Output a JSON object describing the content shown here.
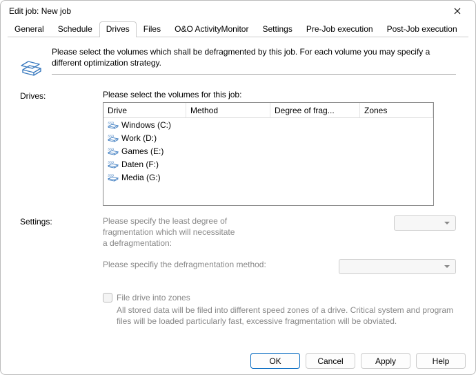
{
  "window": {
    "title": "Edit job: New job"
  },
  "tabs": [
    {
      "label": "General"
    },
    {
      "label": "Schedule"
    },
    {
      "label": "Drives"
    },
    {
      "label": "Files"
    },
    {
      "label": "O&O ActivityMonitor"
    },
    {
      "label": "Settings"
    },
    {
      "label": "Pre-Job execution"
    },
    {
      "label": "Post-Job execution"
    }
  ],
  "intro": "Please select the volumes which shall be defragmented by this job. For each volume you may specify a different optimization strategy.",
  "drives": {
    "section_label": "Drives:",
    "prompt": "Please select the volumes for this job:",
    "columns": [
      "Drive",
      "Method",
      "Degree of frag...",
      "Zones"
    ],
    "rows": [
      {
        "name": "Windows (C:)",
        "method": "<disabled>",
        "frag": "<disabled>",
        "zones": ""
      },
      {
        "name": "Work (D:)",
        "method": "<disabled>",
        "frag": "<disabled>",
        "zones": ""
      },
      {
        "name": "Games (E:)",
        "method": "<disabled>",
        "frag": "<disabled>",
        "zones": ""
      },
      {
        "name": "Daten (F:)",
        "method": "<disabled>",
        "frag": "<disabled>",
        "zones": ""
      },
      {
        "name": "Media (G:)",
        "method": "<disabled>",
        "frag": "<disabled>",
        "zones": ""
      }
    ]
  },
  "settings": {
    "section_label": "Settings:",
    "frag_desc": "Please specify the least degree of fragmentation which will necessitate a defragmentation:",
    "method_desc": "Please specifiy the defragmentation method:",
    "zones_label": "File drive into zones",
    "zones_desc": "All stored data will be filed into different speed zones of a drive. Critical system and program files will be loaded particularly fast, excessive fragmentation will be obviated."
  },
  "buttons": {
    "ok": "OK",
    "cancel": "Cancel",
    "apply": "Apply",
    "help": "Help"
  }
}
